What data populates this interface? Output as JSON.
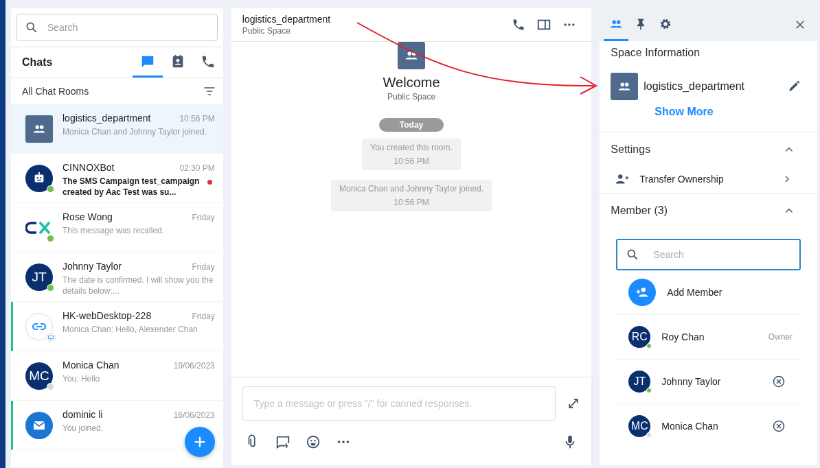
{
  "sidebar": {
    "search": {
      "placeholder": "Search"
    },
    "title": "Chats",
    "tabs": [
      {
        "kind": "chats",
        "selected": true
      },
      {
        "kind": "contacts",
        "selected": false
      },
      {
        "kind": "calls",
        "selected": false
      }
    ],
    "filter_label": "All Chat Rooms",
    "chats": [
      {
        "name": "logistics_department",
        "preview": "Monica Chan and Johnny Taylor joined.",
        "time": "10:56 PM",
        "kind": "group",
        "selected": true,
        "unread": false,
        "flagged": false
      },
      {
        "name": "CINNOXBot",
        "preview": "The SMS Campaign test_campaign created by Aac Test was su...",
        "time": "02:30 PM",
        "kind": "bot",
        "online": true,
        "selected": false,
        "unread": true,
        "flagged": false
      },
      {
        "name": "Rose Wong",
        "preview": "This message was recalled.",
        "time": "Friday",
        "kind": "logo",
        "online": true,
        "selected": false,
        "unread": false,
        "flagged": false
      },
      {
        "name": "Johnny Taylor",
        "preview": "The date is confirmed. I will show you the details below:...",
        "time": "Friday",
        "kind": "initials",
        "initials": "JT",
        "online": true,
        "selected": false,
        "unread": false,
        "flagged": false
      },
      {
        "name": "HK-webDesktop-228",
        "preview": "Monica Chan: Hello, Alexender Chan",
        "time": "Friday",
        "kind": "link",
        "device_badge": true,
        "selected": false,
        "unread": false,
        "flagged": true
      },
      {
        "name": "Monica Chan",
        "preview": "You: Hello",
        "time": "19/06/2023",
        "kind": "initials",
        "initials": "MC",
        "online": false,
        "selected": false,
        "unread": false,
        "flagged": false
      },
      {
        "name": "dominic li",
        "preview": "You joined.",
        "time": "16/06/2023",
        "kind": "mail",
        "selected": false,
        "unread": false,
        "flagged": true
      }
    ]
  },
  "conversation": {
    "title": "logistics_department",
    "subtitle": "Public Space",
    "welcome": "Welcome",
    "welcome_subtitle": "Public Space",
    "date_chip": "Today",
    "events": [
      {
        "text": "You created this room.",
        "time": "10:56 PM"
      },
      {
        "text": "Monica Chan and Johnny Taylor joined.",
        "time": "10:56 PM"
      }
    ],
    "composer": {
      "placeholder": "Type a message or press \"/\" for canned responses."
    }
  },
  "details": {
    "tabs": [
      {
        "kind": "members",
        "selected": true
      },
      {
        "kind": "pinned",
        "selected": false
      },
      {
        "kind": "settings",
        "selected": false
      }
    ],
    "space_heading": "Space Information",
    "space_name": "logistics_department",
    "show_more": "Show More",
    "settings": {
      "heading": "Settings",
      "expanded": true,
      "items": [
        {
          "label": "Transfer Ownership"
        }
      ]
    },
    "members": {
      "heading": "Member (3)",
      "expanded": true,
      "search": {
        "placeholder": "Search"
      },
      "add_label": "Add Member",
      "list": [
        {
          "initials": "RC",
          "name": "Roy Chan",
          "online": true,
          "kind": "owner",
          "role": "Owner"
        },
        {
          "initials": "JT",
          "name": "Johnny Taylor",
          "online": true,
          "kind": "member"
        },
        {
          "initials": "MC",
          "name": "Monica Chan",
          "online": false,
          "kind": "member"
        }
      ]
    }
  }
}
